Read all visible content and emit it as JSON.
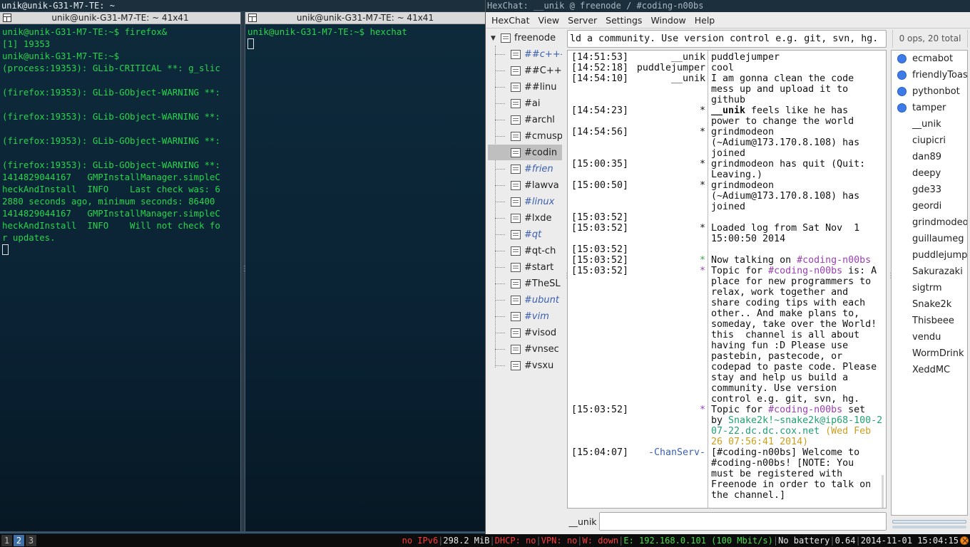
{
  "wm": {
    "title": "unik@unik-G31-M7-TE: ~"
  },
  "terminal1": {
    "title": "unik@unik-G31-M7-TE: ~ 41x41",
    "lines": [
      "unik@unik-G31-M7-TE:~$ firefox&",
      "[1] 19353",
      "unik@unik-G31-M7-TE:~$",
      "(process:19353): GLib-CRITICAL **: g_slic",
      "",
      "(firefox:19353): GLib-GObject-WARNING **:",
      "",
      "(firefox:19353): GLib-GObject-WARNING **:",
      "",
      "(firefox:19353): GLib-GObject-WARNING **:",
      "",
      "(firefox:19353): GLib-GObject-WARNING **:",
      "1414829044167   GMPInstallManager.simpleC",
      "heckAndInstall  INFO    Last check was: 6",
      "2880 seconds ago, minimum seconds: 86400",
      "1414829044167   GMPInstallManager.simpleC",
      "heckAndInstall  INFO    Will not check fo",
      "r updates."
    ]
  },
  "terminal2": {
    "title": "unik@unik-G31-M7-TE: ~ 41x41",
    "lines": [
      "unik@unik-G31-M7-TE:~$ hexchat"
    ]
  },
  "hexchat": {
    "window_title": "HexChat: __unik @ freenode / #coding-n00bs",
    "menu": [
      "HexChat",
      "View",
      "Server",
      "Settings",
      "Window",
      "Help"
    ],
    "network": "freenode",
    "channels": [
      {
        "name": "##c++-",
        "highlight": true
      },
      {
        "name": "##C++-",
        "highlight": false
      },
      {
        "name": "##linu",
        "highlight": false
      },
      {
        "name": "#ai",
        "highlight": false
      },
      {
        "name": "#archl",
        "highlight": false
      },
      {
        "name": "#cmusp",
        "highlight": false
      },
      {
        "name": "#codin",
        "highlight": false,
        "selected": true
      },
      {
        "name": "#frien",
        "highlight": true
      },
      {
        "name": "#lawva",
        "highlight": false
      },
      {
        "name": "#linux",
        "highlight": true
      },
      {
        "name": "#lxde",
        "highlight": false
      },
      {
        "name": "#qt",
        "highlight": true
      },
      {
        "name": "#qt-ch",
        "highlight": false
      },
      {
        "name": "#start",
        "highlight": false
      },
      {
        "name": "#TheSL",
        "highlight": false
      },
      {
        "name": "#ubunt",
        "highlight": true
      },
      {
        "name": "#vim",
        "highlight": true
      },
      {
        "name": "#visod",
        "highlight": false
      },
      {
        "name": "#vnsec",
        "highlight": false
      },
      {
        "name": "#vsxu",
        "highlight": false
      }
    ],
    "topic": "ld a community. Use version  control e.g. git, svn, hg.",
    "ops_count": "0 ops, 20 total",
    "nick": "__unik",
    "users": [
      {
        "name": "ecmabot",
        "op": true
      },
      {
        "name": "friendlyToaster",
        "op": true
      },
      {
        "name": "pythonbot",
        "op": true
      },
      {
        "name": "tamper",
        "op": true
      },
      {
        "name": "__unik",
        "op": false
      },
      {
        "name": "ciupicri",
        "op": false
      },
      {
        "name": "dan89",
        "op": false
      },
      {
        "name": "deepy",
        "op": false
      },
      {
        "name": "gde33",
        "op": false
      },
      {
        "name": "geordi",
        "op": false
      },
      {
        "name": "grindmodeon",
        "op": false
      },
      {
        "name": "guillaumeg",
        "op": false
      },
      {
        "name": "puddlejumper",
        "op": false
      },
      {
        "name": "Sakurazaki",
        "op": false
      },
      {
        "name": "sigtrm",
        "op": false
      },
      {
        "name": "Snake2k",
        "op": false
      },
      {
        "name": "Thisbeee",
        "op": false
      },
      {
        "name": "vendu",
        "op": false
      },
      {
        "name": "WormDrink",
        "op": false
      },
      {
        "name": "XeddMC",
        "op": false
      }
    ],
    "messages": [
      {
        "ts": "[14:51:53]",
        "nick": "__unik",
        "kind": "nick",
        "lines": [
          "puddlejumper"
        ]
      },
      {
        "ts": "[14:52:18]",
        "nick": "puddlejumper",
        "kind": "nick",
        "lines": [
          "cool"
        ]
      },
      {
        "ts": "[14:54:10]",
        "nick": "__unik",
        "kind": "nick",
        "lines": [
          "I am gonna clean the code",
          "mess up and upload it to",
          "github"
        ]
      },
      {
        "ts": "[14:54:23]",
        "nick": "*",
        "kind": "star",
        "lines": [
          "__unik feels like he has",
          "power to change the world"
        ]
      },
      {
        "ts": "[14:54:56]",
        "nick": "*",
        "kind": "star",
        "lines": [
          "grindmodeon",
          "(~Adium@173.170.8.108) has",
          "joined"
        ]
      },
      {
        "ts": "[15:00:35]",
        "nick": "*",
        "kind": "star",
        "lines": [
          "grindmodeon has quit (Quit:",
          "Leaving.)"
        ]
      },
      {
        "ts": "[15:00:50]",
        "nick": "*",
        "kind": "star",
        "lines": [
          "grindmodeon",
          "(~Adium@173.170.8.108) has",
          "joined"
        ]
      },
      {
        "ts": "[15:03:52]",
        "nick": "",
        "kind": "blank",
        "lines": [
          ""
        ]
      },
      {
        "ts": "[15:03:52]",
        "nick": "*",
        "kind": "star",
        "lines": [
          "Loaded log from Sat Nov  1",
          "15:00:50 2014"
        ]
      },
      {
        "ts": "[15:03:52]",
        "nick": "",
        "kind": "blank",
        "lines": [
          ""
        ]
      },
      {
        "ts": "[15:03:52]",
        "nick": "*",
        "kind": "star-green",
        "lines": [
          "Now talking on #coding-n00bs"
        ]
      },
      {
        "ts": "[15:03:52]",
        "nick": "*",
        "kind": "star-purple",
        "lines": [
          "Topic for #coding-n00bs is: A",
          "place for new programmers to",
          "relax, work together and",
          "share coding tips with each",
          "other.. And make plans to,",
          "someday, take over the World!",
          "this  channel is all about",
          "having fun :D Please use",
          "pastebin, pastecode, or",
          "codepad to paste code. Please",
          "stay and help us build a",
          "community. Use version",
          "control e.g. git, svn, hg."
        ]
      },
      {
        "ts": "[15:03:52]",
        "nick": "*",
        "kind": "star-purple",
        "lines": [
          "Topic for #coding-n00bs set",
          "by Snake2k!~snake2k@ip68-100-2",
          "07-22.dc.dc.cox.net (Wed Feb",
          "26 07:56:41 2014)"
        ]
      },
      {
        "ts": "[15:04:07]",
        "nick": "-ChanServ-",
        "kind": "chanserv",
        "lines": [
          "[#coding-n00bs] Welcome to",
          "#coding-n00bs! [NOTE: You",
          "must be registered with",
          "Freenode in order to talk on",
          "the channel.]"
        ]
      }
    ]
  },
  "statusbar": {
    "workspaces": [
      "1",
      "2",
      "3"
    ],
    "active_workspace": "2",
    "ipv6": "no IPv6",
    "memory": "298.2 MiB",
    "dhcp": "DHCP: no",
    "vpn": "VPN: no",
    "wireless": "W: down",
    "ethernet": "E: 192.168.0.101 (100 Mbit/s)",
    "battery": "No battery",
    "load": "0.64",
    "datetime": "2014-11-01 15:04:15"
  },
  "colors": {
    "terminal_text": "#27d64a",
    "chan_highlight": "#3a5fae",
    "op_dot": "#3c7be8",
    "status_red": "#ff3b3b",
    "status_green": "#4ade4a",
    "active_workspace": "#3d6fa8"
  }
}
